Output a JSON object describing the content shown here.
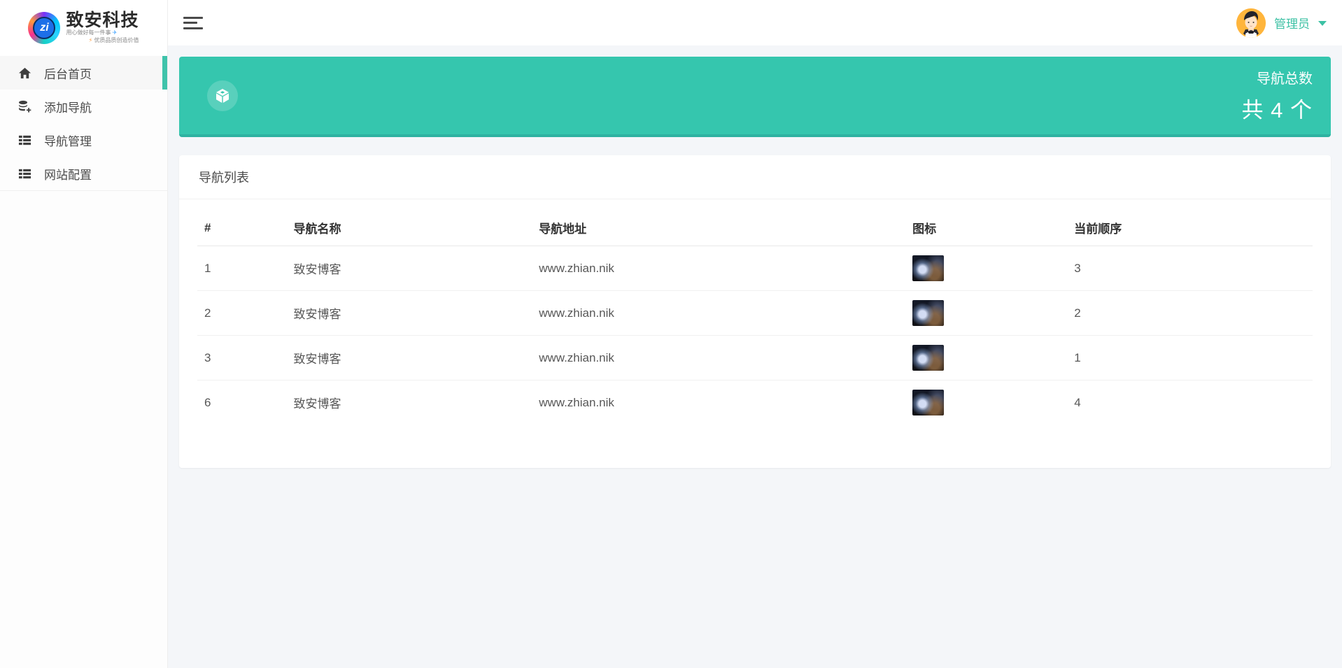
{
  "brand": {
    "title": "致安科技",
    "badge_text": "zi",
    "tagline1": "用心做好每一件事",
    "tagline1_icon": "✈",
    "tagline2": "优质品质创造价值",
    "tagline2_icon": "⚡"
  },
  "header": {
    "user_name": "管理员"
  },
  "sidebar": {
    "items": [
      {
        "label": "后台首页",
        "icon": "home-icon",
        "active": true
      },
      {
        "label": "添加导航",
        "icon": "add-nav-icon",
        "active": false
      },
      {
        "label": "导航管理",
        "icon": "nav-manage-icon",
        "active": false
      },
      {
        "label": "网站配置",
        "icon": "site-config-icon",
        "active": false
      }
    ]
  },
  "banner": {
    "icon": "cube-icon",
    "label": "导航总数",
    "count_text": "共 4 个"
  },
  "table_card": {
    "title": "导航列表",
    "columns": [
      "#",
      "导航名称",
      "导航地址",
      "图标",
      "当前顺序"
    ],
    "rows": [
      {
        "id": "1",
        "name": "致安博客",
        "url": "www.zhian.nik",
        "order": "3"
      },
      {
        "id": "2",
        "name": "致安博客",
        "url": "www.zhian.nik",
        "order": "2"
      },
      {
        "id": "3",
        "name": "致安博客",
        "url": "www.zhian.nik",
        "order": "1"
      },
      {
        "id": "6",
        "name": "致安博客",
        "url": "www.zhian.nik",
        "order": "4"
      }
    ]
  },
  "colors": {
    "banner_teal": "#35c6ae",
    "banner_teal_dark": "#2eb2a1",
    "active_bar_teal": "#3fc3ab",
    "user_name_teal": "#3cc1a4",
    "avatar_bg": "#ffb53c",
    "page_bg": "#f4f6f9"
  }
}
